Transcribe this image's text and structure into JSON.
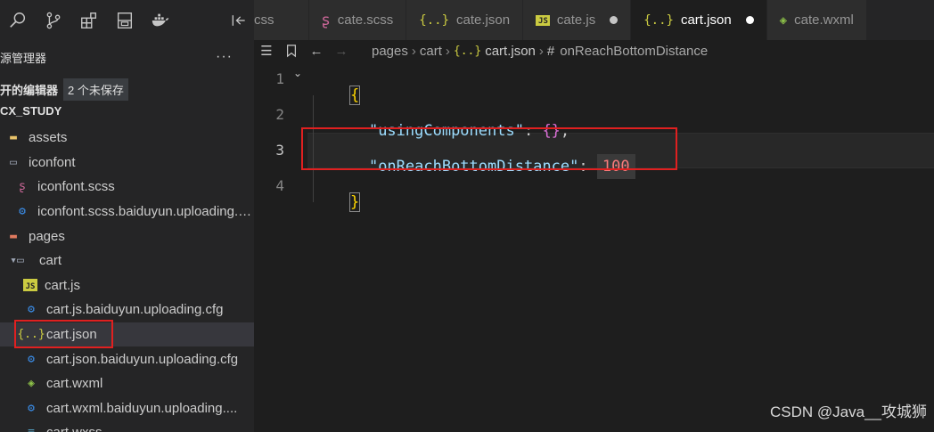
{
  "colors": {
    "accent_red": "#e02020",
    "editor_bg": "#1e1e1e",
    "sidebar_bg": "#252526"
  },
  "activity_bar": {
    "icons": [
      "search-icon",
      "source-control-icon",
      "extensions-icon",
      "remote-icon",
      "docker-icon"
    ]
  },
  "tabs": [
    {
      "label": "css",
      "icon": "",
      "icon_color": "#cccccc",
      "active": false,
      "dirty": false
    },
    {
      "label": "cate.scss",
      "icon": "sass-icon",
      "icon_color": "#cd6799",
      "active": false,
      "dirty": false
    },
    {
      "label": "cate.json",
      "icon": "{..}",
      "icon_color": "#cbcb41",
      "active": false,
      "dirty": false
    },
    {
      "label": "cate.js",
      "icon": "JS",
      "icon_color": "#cbcb41",
      "active": false,
      "dirty": true
    },
    {
      "label": "cart.json",
      "icon": "{..}",
      "icon_color": "#cbcb41",
      "active": true,
      "dirty": true
    },
    {
      "label": "cate.wxml",
      "icon": "wxml-icon",
      "icon_color": "#8dc149",
      "active": false,
      "dirty": false
    }
  ],
  "sidebar": {
    "title": "源管理器",
    "more": "···",
    "open_editors": "开的编辑器",
    "unsaved_badge": "2 个未保存",
    "workspace": "CX_STUDY",
    "tree": [
      {
        "label": "assets",
        "icon": "folder",
        "indent": 6
      },
      {
        "label": "iconfont",
        "icon": "folder-open",
        "indent": 6
      },
      {
        "label": "iconfont.scss",
        "icon": "sass",
        "indent": 16
      },
      {
        "label": "iconfont.scss.baiduyun.uploading.cfg",
        "icon": "gear",
        "indent": 16
      },
      {
        "label": "pages",
        "icon": "folder-pages",
        "indent": 6
      },
      {
        "label": "cart",
        "icon": "folder-open-chevron",
        "indent": 2
      },
      {
        "label": "cart.js",
        "icon": "js",
        "indent": 26
      },
      {
        "label": "cart.js.baiduyun.uploading.cfg",
        "icon": "gear",
        "indent": 26
      },
      {
        "label": "cart.json",
        "icon": "json",
        "indent": 26,
        "selected": true
      },
      {
        "label": "cart.json.baiduyun.uploading.cfg",
        "icon": "gear",
        "indent": 26
      },
      {
        "label": "cart.wxml",
        "icon": "wxml",
        "indent": 26
      },
      {
        "label": "cart.wxml.baiduyun.uploading....",
        "icon": "gear",
        "indent": 26
      },
      {
        "label": "cart.wxss",
        "icon": "wxss",
        "indent": 26
      }
    ]
  },
  "breadcrumb": {
    "parts": [
      "pages",
      "cart"
    ],
    "file": "cart.json",
    "symbol": "onReachBottomDistance",
    "file_icon": "{..}"
  },
  "editor": {
    "line_numbers": [
      "1",
      "2",
      "3",
      "4"
    ],
    "open_brace": "{",
    "close_brace": "}",
    "line2_key": "\"usingComponents\"",
    "line2_colon": ": ",
    "line2_value": "{}",
    "line2_comma": ",",
    "line3_key": "\"onReachBottomDistance\"",
    "line3_colon": ": ",
    "line3_value": "100"
  },
  "watermark": "CSDN @Java__攻城狮"
}
